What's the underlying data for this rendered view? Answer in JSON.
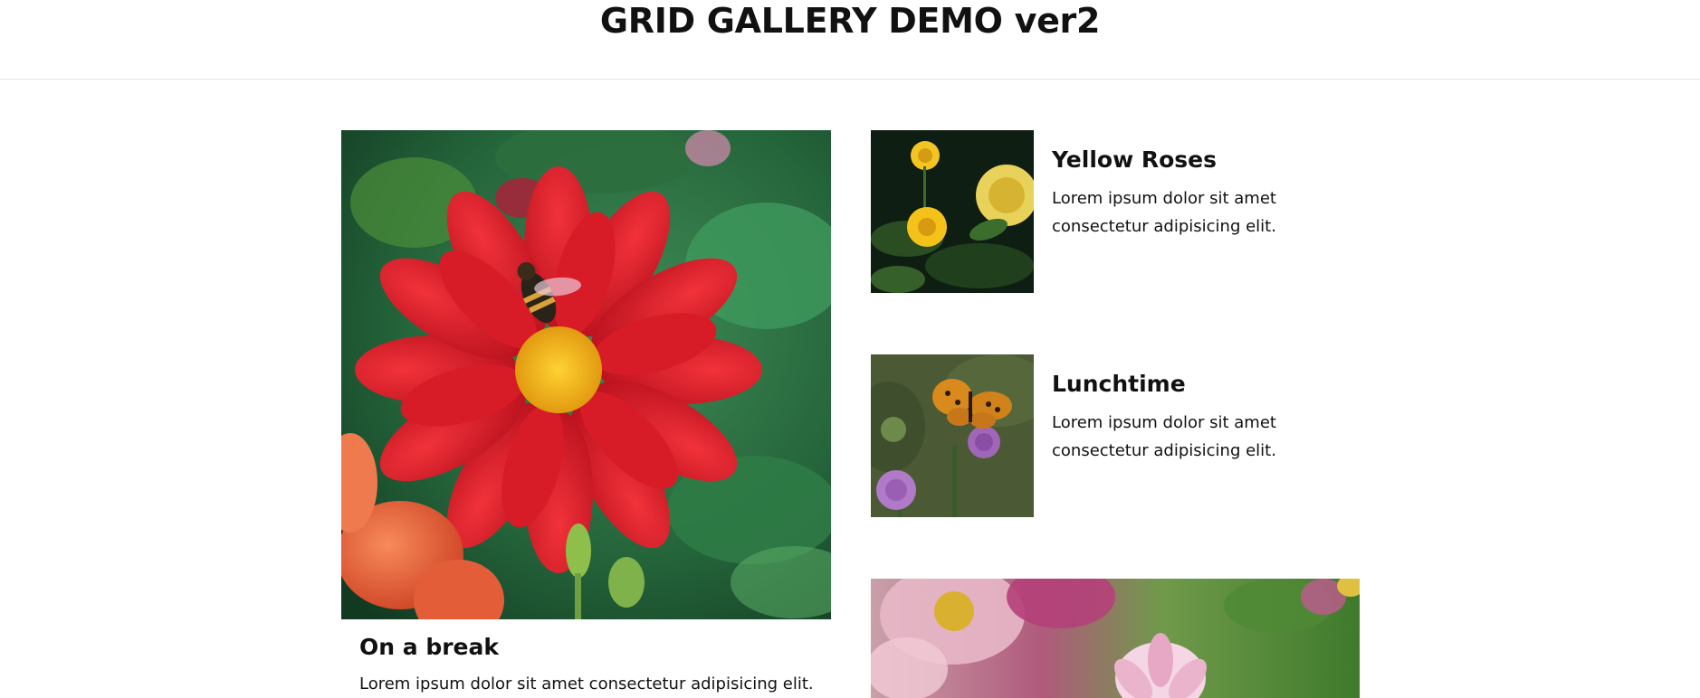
{
  "header": {
    "title": "GRID GALLERY DEMO ver2"
  },
  "gallery": {
    "feature": {
      "title": "On a break",
      "text": "Lorem ipsum dolor sit amet consectetur adipisicing elit.",
      "image_icon": "red-dahlia-bee-photo"
    },
    "items": [
      {
        "title": "Yellow Roses",
        "text": "Lorem ipsum dolor sit amet consectetur adipisicing elit.",
        "image_icon": "yellow-roses-photo"
      },
      {
        "title": "Lunchtime",
        "text": "Lorem ipsum dolor sit amet consectetur adipisicing elit.",
        "image_icon": "butterfly-thistle-photo"
      }
    ],
    "wide": {
      "image_icon": "pink-dahlia-photo"
    }
  },
  "colors": {
    "text": "#111111",
    "divider": "#e4e4e4",
    "background": "#ffffff"
  }
}
